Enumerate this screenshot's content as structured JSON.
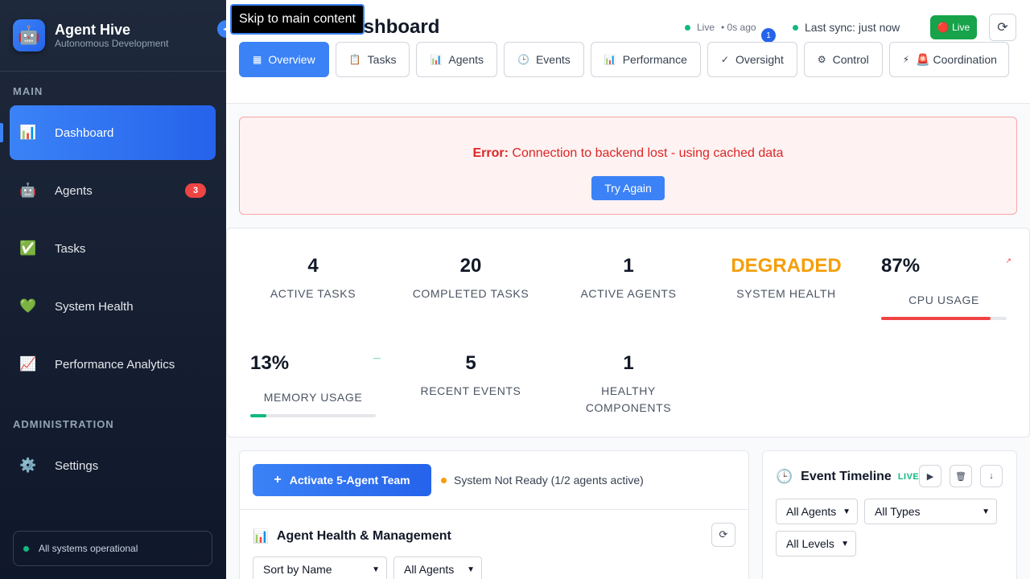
{
  "brand": {
    "title": "Agent Hive",
    "subtitle": "Autonomous Development",
    "logo_icon": "robot-icon"
  },
  "sidebar": {
    "main_label": "MAIN",
    "items": [
      {
        "label": "Dashboard",
        "icon": "📊",
        "active": true
      },
      {
        "label": "Agents",
        "icon": "🤖",
        "badge": "3"
      },
      {
        "label": "Tasks",
        "icon": "✅"
      },
      {
        "label": "System Health",
        "icon": "💚"
      },
      {
        "label": "Performance Analytics",
        "icon": "📈"
      }
    ],
    "admin_label": "ADMINISTRATION",
    "admin_items": [
      {
        "label": "Settings",
        "icon": "⚙️"
      }
    ],
    "footer_status": "All systems operational"
  },
  "header": {
    "title": "Dashboard",
    "skip_link": "Skip to main content",
    "live_mini": "Live",
    "live_ago": "• 0s ago",
    "notification_count": "1",
    "last_sync": "Last sync: just now",
    "live_button": "🔴 Live"
  },
  "tabs": [
    {
      "label": "Overview",
      "icon": "▦",
      "active": true
    },
    {
      "label": "Tasks",
      "icon": "📋"
    },
    {
      "label": "Agents",
      "icon": "📊"
    },
    {
      "label": "Events",
      "icon": "🕒"
    },
    {
      "label": "Performance",
      "icon": "📊"
    },
    {
      "label": "Oversight",
      "icon": "✓"
    },
    {
      "label": "Control",
      "icon": "⚙"
    },
    {
      "label": "🚨 Coordination",
      "icon": "⚡"
    }
  ],
  "error": {
    "prefix": "Error:",
    "message": " Connection to backend lost - using cached data",
    "retry": "Try Again"
  },
  "metrics": [
    {
      "value": "4",
      "label": "ACTIVE TASKS"
    },
    {
      "value": "20",
      "label": "COMPLETED TASKS"
    },
    {
      "value": "1",
      "label": "ACTIVE AGENTS"
    },
    {
      "value": "DEGRADED",
      "label": "SYSTEM HEALTH",
      "status_color": "#f59e0b"
    },
    {
      "value": "87%",
      "label": "CPU USAGE",
      "progress": 0.87,
      "bar_color": "#ef4444",
      "trend": "↗"
    },
    {
      "value": "13%",
      "label": "MEMORY USAGE",
      "progress": 0.13,
      "bar_color": "#10b981",
      "trend": "—"
    },
    {
      "value": "5",
      "label": "RECENT EVENTS"
    },
    {
      "value": "1",
      "label": "HEALTHY\nCOMPONENTS"
    }
  ],
  "team_panel": {
    "activate_button": "Activate 5-Agent Team",
    "ready_status": "System Not Ready (1/2 agents active)",
    "title": "Agent Health & Management",
    "sort_select": "Sort by Name",
    "filter_select": "All Agents"
  },
  "timeline": {
    "title": "Event Timeline",
    "live_tag": "LIVE",
    "agents_select": "All Agents",
    "types_select": "All Types",
    "levels_select": "All Levels"
  },
  "colors": {
    "accent": "#3b82f6",
    "danger": "#ef4444",
    "success": "#10b981",
    "warning": "#f59e0b"
  }
}
